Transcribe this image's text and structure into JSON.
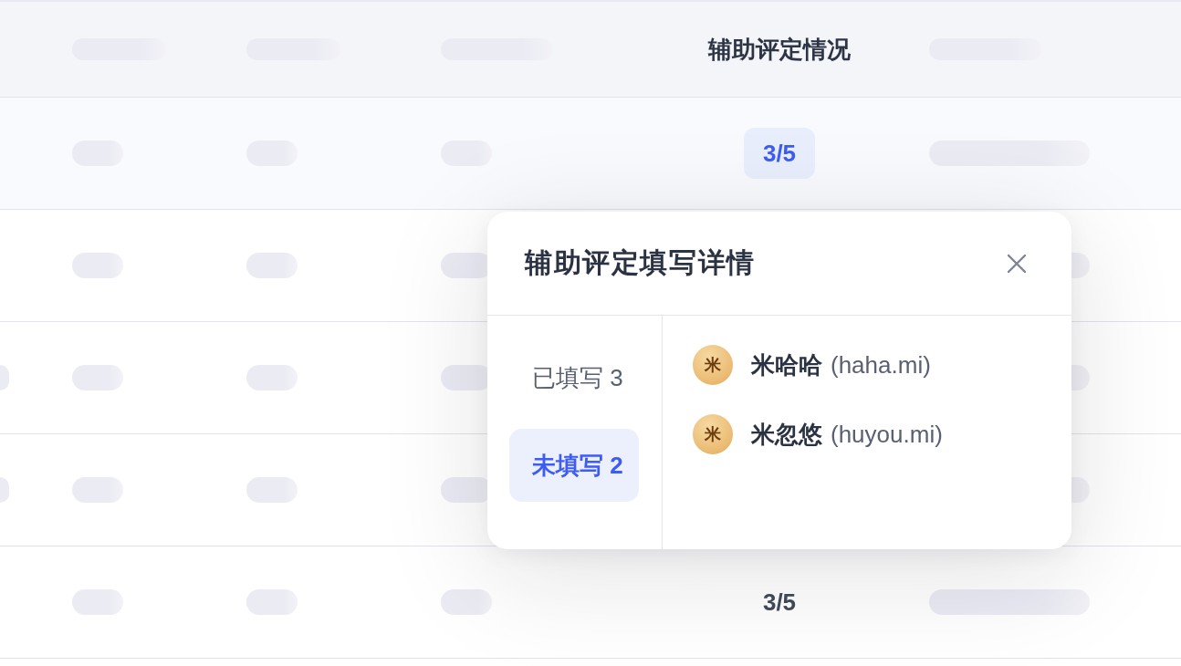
{
  "table": {
    "header": [
      {
        "kind": "blank"
      },
      {
        "kind": "bar"
      },
      {
        "kind": "bar"
      },
      {
        "kind": "bar"
      },
      {
        "kind": "text",
        "label": "辅助评定情况"
      },
      {
        "kind": "bar"
      }
    ],
    "rows": [
      {
        "cells": [
          {
            "kind": "blank"
          },
          {
            "kind": "bar"
          },
          {
            "kind": "bar"
          },
          {
            "kind": "bar"
          },
          {
            "kind": "score",
            "text": "3/5",
            "highlighted": true
          },
          {
            "kind": "bar"
          }
        ]
      },
      {
        "cells": [
          {
            "kind": "blank"
          },
          {
            "kind": "bar"
          },
          {
            "kind": "bar"
          },
          {
            "kind": "bar"
          },
          {
            "kind": "blank"
          },
          {
            "kind": "bar"
          }
        ]
      },
      {
        "cells": [
          {
            "kind": "bar"
          },
          {
            "kind": "bar"
          },
          {
            "kind": "bar"
          },
          {
            "kind": "bar"
          },
          {
            "kind": "blank"
          },
          {
            "kind": "bar"
          }
        ]
      },
      {
        "cells": [
          {
            "kind": "bar"
          },
          {
            "kind": "bar"
          },
          {
            "kind": "bar"
          },
          {
            "kind": "bar"
          },
          {
            "kind": "blank"
          },
          {
            "kind": "bar"
          }
        ]
      },
      {
        "cells": [
          {
            "kind": "blank"
          },
          {
            "kind": "bar"
          },
          {
            "kind": "bar"
          },
          {
            "kind": "bar"
          },
          {
            "kind": "score",
            "text": "3/5",
            "highlighted": false
          },
          {
            "kind": "bar"
          }
        ]
      }
    ]
  },
  "popover": {
    "title": "辅助评定填写详情",
    "tabs": [
      {
        "label": "已填写 3",
        "selected": false
      },
      {
        "label": "未填写 2",
        "selected": true
      }
    ],
    "members": [
      {
        "avatar": "米",
        "name": "米哈哈",
        "account": "(haha.mi)"
      },
      {
        "avatar": "米",
        "name": "米忽悠",
        "account": "(huyou.mi)"
      }
    ]
  }
}
